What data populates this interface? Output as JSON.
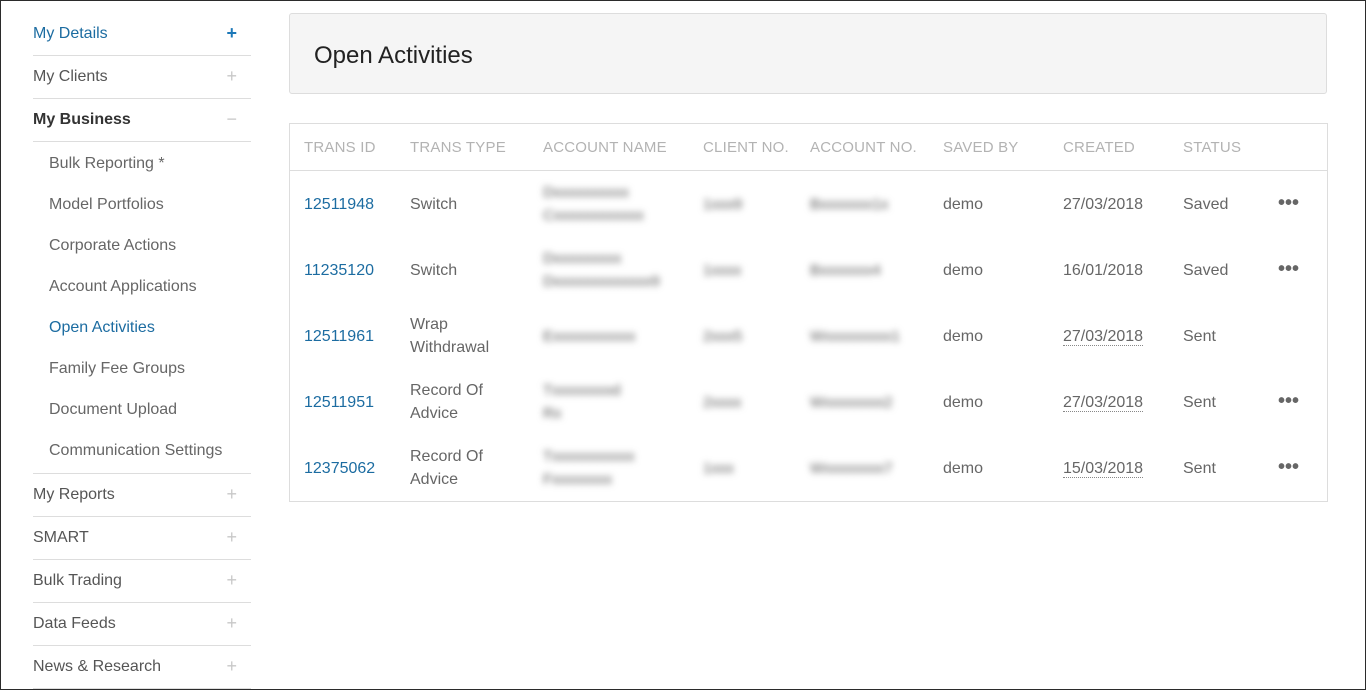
{
  "sidebar": {
    "items_top": [
      {
        "label": "My Details",
        "sign": "+"
      },
      {
        "label": "My Clients",
        "sign": "+"
      },
      {
        "label": "My Business",
        "sign": "−"
      }
    ],
    "subitems": [
      "Bulk Reporting *",
      "Model Portfolios",
      "Corporate Actions",
      "Account Applications",
      "Open Activities",
      "Family Fee Groups",
      "Document Upload",
      "Communication Settings"
    ],
    "items_bottom": [
      {
        "label": "My Reports",
        "sign": "+"
      },
      {
        "label": "SMART",
        "sign": "+"
      },
      {
        "label": "Bulk Trading",
        "sign": "+"
      },
      {
        "label": "Data Feeds",
        "sign": "+"
      },
      {
        "label": "News & Research",
        "sign": "+"
      }
    ]
  },
  "page": {
    "title": "Open Activities"
  },
  "table": {
    "headers": [
      "TRANS ID",
      "TRANS TYPE",
      "ACCOUNT NAME",
      "CLIENT NO.",
      "ACCOUNT NO.",
      "SAVED BY",
      "CREATED",
      "STATUS"
    ],
    "rows": [
      {
        "id": "12511948",
        "type": "Switch",
        "name_l1": "Dxxxxxxxxxx",
        "name_l2": "Cxxxxxxxxxxxx",
        "client": "1xxx9",
        "account": "Bxxxxxxx1x",
        "saved_by": "demo",
        "created": "27/03/2018",
        "status": "Saved",
        "more": "•••"
      },
      {
        "id": "11235120",
        "type": "Switch",
        "name_l1": "Dxxxxxxxxx",
        "name_l2": "Dxxxxxxxxxxxxx9",
        "client": "1xxxx",
        "account": "Bxxxxxxx4",
        "saved_by": "demo",
        "created": "16/01/2018",
        "status": "Saved",
        "more": "•••"
      },
      {
        "id": "12511961",
        "type_l1": "Wrap",
        "type_l2": "Withdrawal",
        "name_l1": "Exxxxxxxxxxx",
        "name_l2": "",
        "client": "2xxx5",
        "account": "Wxxxxxxxxx1",
        "saved_by": "demo",
        "created": "27/03/2018",
        "status": "Sent",
        "more": ""
      },
      {
        "id": "12511951",
        "type_l1": "Record Of",
        "type_l2": "Advice",
        "name_l1": "Txxxxxxxxd",
        "name_l2": "Rx",
        "client": "2xxxx",
        "account": "Wxxxxxxxx2",
        "saved_by": "demo",
        "created": "27/03/2018",
        "status": "Sent",
        "more": "•••"
      },
      {
        "id": "12375062",
        "type_l1": "Record Of",
        "type_l2": "Advice",
        "name_l1": "Txxxxxxxxxxx",
        "name_l2": "Fxxxxxxxx",
        "client": "1xxx",
        "account": "Wxxxxxxxx7",
        "saved_by": "demo",
        "created": "15/03/2018",
        "status": "Sent",
        "more": "•••"
      }
    ]
  }
}
